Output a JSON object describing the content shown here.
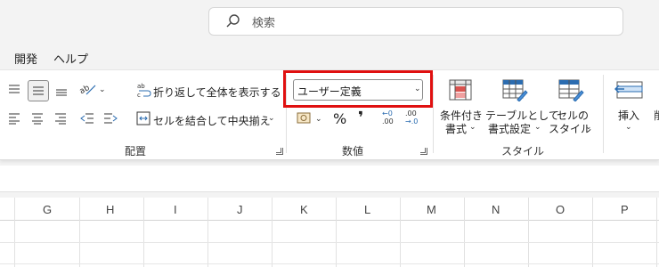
{
  "search": {
    "placeholder": "検索"
  },
  "menu": {
    "items": [
      "開発",
      "ヘルプ"
    ]
  },
  "alignment": {
    "wrap_text": "折り返して全体を表示する",
    "merge_center": "セルを結合して中央揃え",
    "group_label": "配置"
  },
  "number": {
    "format_value": "ユーザー定義",
    "percent": "%",
    "comma": "❜",
    "inc_top": "←0",
    "inc_bottom": ".00",
    "dec_top": ".00",
    "dec_bottom": "→.0",
    "group_label": "数値"
  },
  "styles": {
    "conditional_1": "条件付き",
    "conditional_2": "書式",
    "table_1": "テーブルとして",
    "table_2": "書式設定",
    "cell_1": "セルの",
    "cell_2": "スタイル",
    "group_label": "スタイル"
  },
  "cells": {
    "insert": "挿入"
  },
  "columns": [
    "G",
    "H",
    "I",
    "J",
    "K",
    "L",
    "M",
    "N",
    "O",
    "P"
  ],
  "colors": {
    "highlight": "#e01010",
    "accent_red": "#d9534f",
    "accent_blue": "#2b6cb0"
  }
}
